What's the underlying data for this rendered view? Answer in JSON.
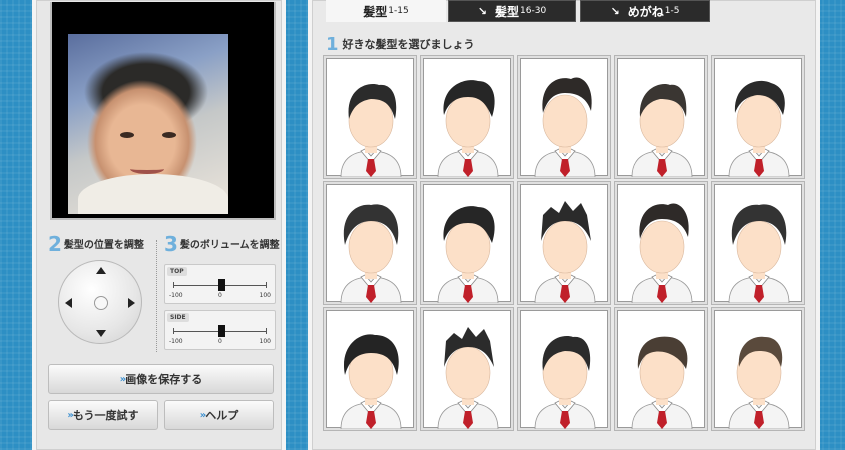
{
  "left": {
    "step2": {
      "num": "2",
      "label": "髪型の位置を調整"
    },
    "step3": {
      "num": "3",
      "label": "髪のボリュームを調整"
    },
    "sliders": [
      {
        "tag": "TOP",
        "min": "-100",
        "mid": "0",
        "max": "100",
        "value": 0
      },
      {
        "tag": "SIDE",
        "min": "-100",
        "mid": "0",
        "max": "100",
        "value": 0
      }
    ],
    "buttons": {
      "save": "画像を保存する",
      "retry": "もう一度試す",
      "help": "ヘルプ"
    },
    "colors": {
      "accent": "#6fb0dc",
      "chevron": "#3a8fd0"
    }
  },
  "tabs": [
    {
      "label": "髪型",
      "range": "1-15",
      "active": true
    },
    {
      "label": "髪型",
      "range": "16-30",
      "active": false,
      "icon": "arrow-down-right-icon"
    },
    {
      "label": "めがね",
      "range": "1-5",
      "active": false,
      "icon": "arrow-down-right-icon"
    }
  ],
  "content": {
    "step1": {
      "num": "1",
      "label": "好きな髪型を選びましょう"
    },
    "hairstyles": [
      {
        "id": 1,
        "style": 0
      },
      {
        "id": 2,
        "style": 1
      },
      {
        "id": 3,
        "style": 2
      },
      {
        "id": 4,
        "style": 3
      },
      {
        "id": 5,
        "style": 4
      },
      {
        "id": 6,
        "style": 5
      },
      {
        "id": 7,
        "style": 1
      },
      {
        "id": 8,
        "style": 6
      },
      {
        "id": 9,
        "style": 2
      },
      {
        "id": 10,
        "style": 5
      },
      {
        "id": 11,
        "style": 7
      },
      {
        "id": 12,
        "style": 6
      },
      {
        "id": 13,
        "style": 0
      },
      {
        "id": 14,
        "style": 8
      },
      {
        "id": 15,
        "style": 9
      }
    ]
  }
}
